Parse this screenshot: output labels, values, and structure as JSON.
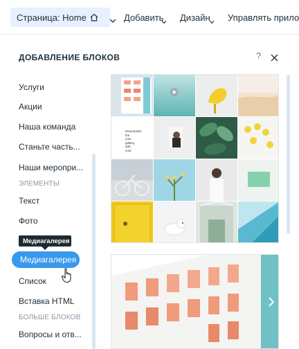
{
  "topbar": {
    "page_select": "Страница: Home",
    "menu": [
      {
        "label": "Добавить"
      },
      {
        "label": "Дизайн"
      },
      {
        "label": "Управлять приложе"
      }
    ]
  },
  "panel": {
    "title": "ДОБАВЛЕНИЕ БЛОКОВ",
    "help": "?"
  },
  "categories": {
    "items": [
      "Услуги",
      "Акции",
      "Наша команда",
      "Станьте часть...",
      "Наши меропри..."
    ],
    "section_elements": "ЭЛЕМЕНТЫ",
    "elements": [
      "Текст",
      "Фото"
    ],
    "active": "Медиагалерея",
    "tooltip": "Медиагалерея",
    "after": [
      "Список",
      "Вставка HTML"
    ],
    "section_more": "БОЛЬШЕ БЛОКОВ",
    "more": [
      "Вопросы и отв..."
    ]
  },
  "gallery": {
    "text_tile": [
      "Personalize",
      "the",
      "your",
      "gallery,",
      "add",
      "your"
    ]
  },
  "colors": {
    "accent": "#3899ec",
    "page_select_bg": "#e7f0ff",
    "text": "#20303c"
  }
}
